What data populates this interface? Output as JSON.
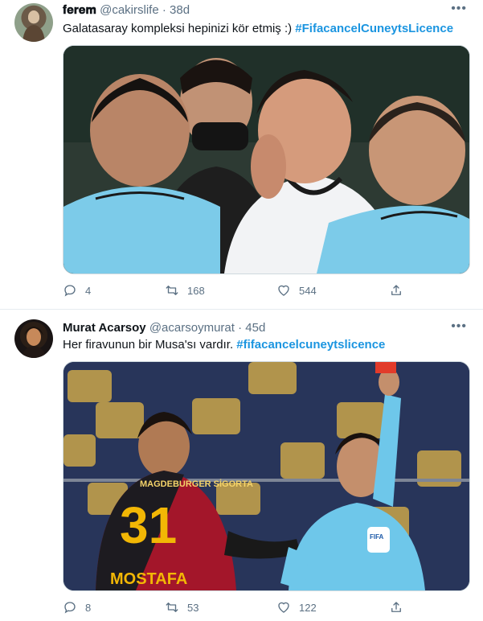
{
  "tweets": [
    {
      "name": "𝐟𝐞𝐫𝐞𝐦",
      "handle": "@cakirslife",
      "time": "38d",
      "text_prefix": "Galatasaray kompleksi hepinizi kör etmiş :) ",
      "hashtag": "#FifacancelCuneytsLicence",
      "replies": "4",
      "retweets": "168",
      "likes": "544"
    },
    {
      "name": "Murat Acarsoy",
      "handle": "@acarsoymurat",
      "time": "45d",
      "text_prefix": "Her firavunun bir Musa'sı vardır. ",
      "hashtag": "#fifacancelcuneytslicence",
      "replies": "8",
      "retweets": "53",
      "likes": "122"
    }
  ],
  "separator": "·",
  "more": "•••",
  "photo_text": {
    "jersey_sponsor": "MAGDEBURGER SİGORTA",
    "jersey_number": "31",
    "jersey_name": "MOSTAFA",
    "badge": "FIFA"
  },
  "colors": {
    "hashtag": "#1b95e0",
    "secondary": "#5b7083",
    "referee_shirt": "#6ec7ea",
    "gs_red": "#b2182b",
    "gs_yellow": "#f2b705"
  }
}
